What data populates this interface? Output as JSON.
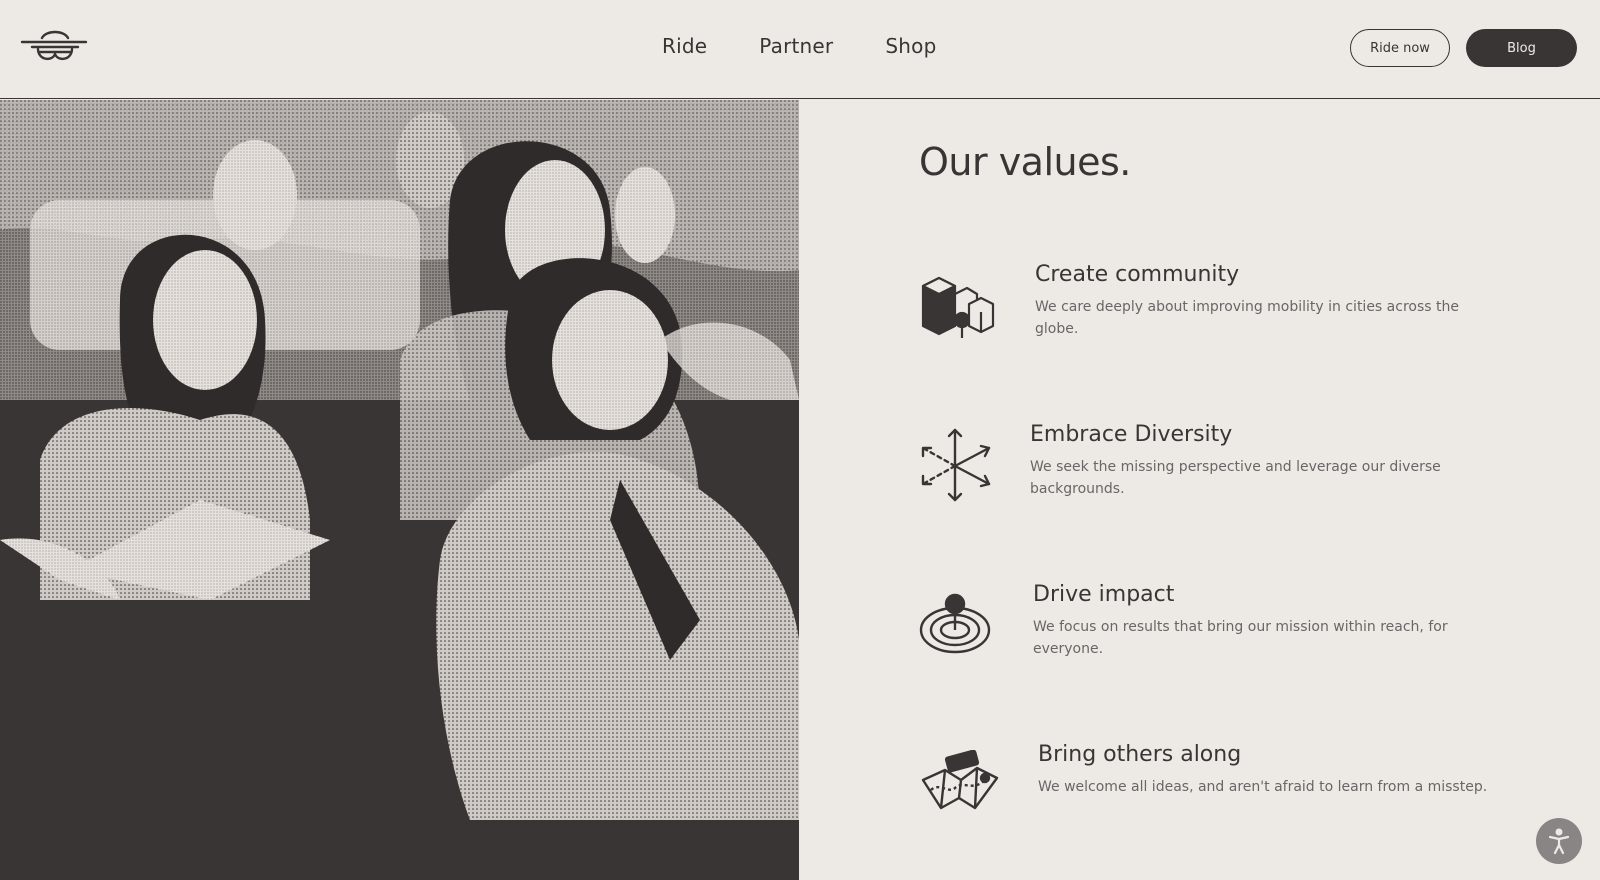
{
  "header": {
    "logo_icon": "bird-wings-logo-icon",
    "nav": [
      {
        "label": "Ride"
      },
      {
        "label": "Partner"
      },
      {
        "label": "Shop"
      }
    ],
    "ride_now_label": "Ride now",
    "blog_label": "Blog"
  },
  "hero": {
    "image_icon": "people-group-photo"
  },
  "values": {
    "title": "Our values.",
    "items": [
      {
        "title": "Create community",
        "description": "We care deeply about improving mobility in cities across the globe.",
        "icon": "buildings-location-pin-icon"
      },
      {
        "title": "Embrace Diversity",
        "description": "We seek the missing perspective and leverage our diverse backgrounds.",
        "icon": "arrows-outward-icon"
      },
      {
        "title": "Drive impact",
        "description": "We focus on results that bring our mission within reach, for everyone.",
        "icon": "target-pin-icon"
      },
      {
        "title": "Bring others along",
        "description": "We welcome all ideas, and aren't afraid to learn from a misstep.",
        "icon": "map-route-icon"
      }
    ]
  },
  "accessibility": {
    "icon": "accessibility-person-icon"
  },
  "colors": {
    "background": "#edeae6",
    "ink": "#3a3535",
    "muted": "#6b6565"
  }
}
